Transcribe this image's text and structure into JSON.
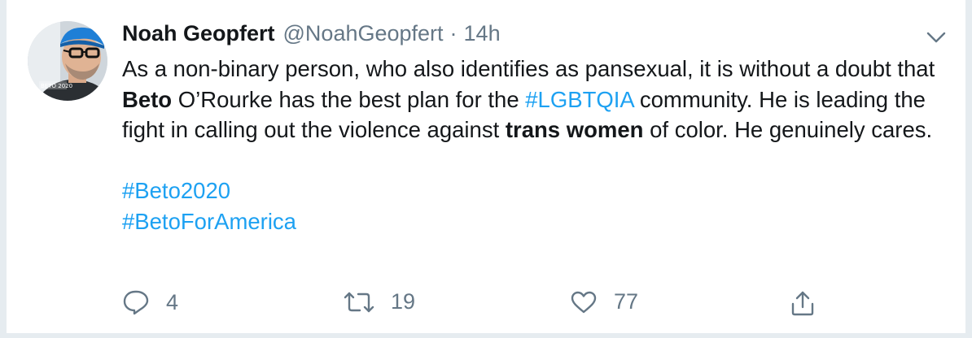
{
  "tweet": {
    "author_name": "Noah Geopfert",
    "handle": "@NoahGeopfert",
    "separator": "·",
    "time": "14h",
    "avatar_caption": "BETO 2020",
    "body": {
      "p1_a": "As a non-binary person, who also identifies as pansexual, it is without a doubt that ",
      "p1_bold1": "Beto",
      "p1_b": " O’Rourke has the best plan for the ",
      "p1_tag": "#LGBTQIA",
      "p1_c": " community. He is leading the fight in calling out the violence against ",
      "p1_bold2": "trans women",
      "p1_d": " of color. He genuinely cares.",
      "hashtag1": "#Beto2020",
      "hashtag2": "#BetoForAmerica"
    },
    "actions": {
      "reply_count": "4",
      "retweet_count": "19",
      "like_count": "77"
    },
    "colors": {
      "link": "#1da1f2",
      "muted": "#657786",
      "text": "#14171a"
    }
  }
}
